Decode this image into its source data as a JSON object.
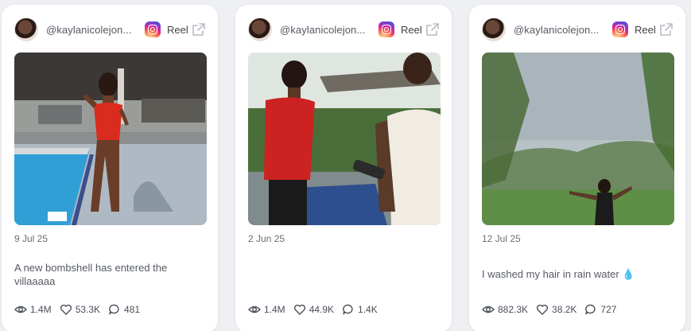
{
  "cards": [
    {
      "handle": "@kaylanicolejon...",
      "platform_icon": "instagram-icon",
      "type": "Reel",
      "date": "9 Jul 25",
      "caption": "A new bombshell has entered the villaaaaa",
      "views": "1.4M",
      "likes": "53.3K",
      "comments": "481"
    },
    {
      "handle": "@kaylanicolejon...",
      "platform_icon": "instagram-icon",
      "type": "Reel",
      "date": "2 Jun 25",
      "caption": "",
      "views": "1.4M",
      "likes": "44.9K",
      "comments": "1.4K"
    },
    {
      "handle": "@kaylanicolejon...",
      "platform_icon": "instagram-icon",
      "type": "Reel",
      "date": "12 Jul 25",
      "caption": "I washed my hair in rain water 💧",
      "views": "882.3K",
      "likes": "38.2K",
      "comments": "727"
    }
  ],
  "colors": {
    "card_bg": "#ffffff",
    "page_bg": "#eef0f4",
    "text_muted": "#6b6f78"
  }
}
